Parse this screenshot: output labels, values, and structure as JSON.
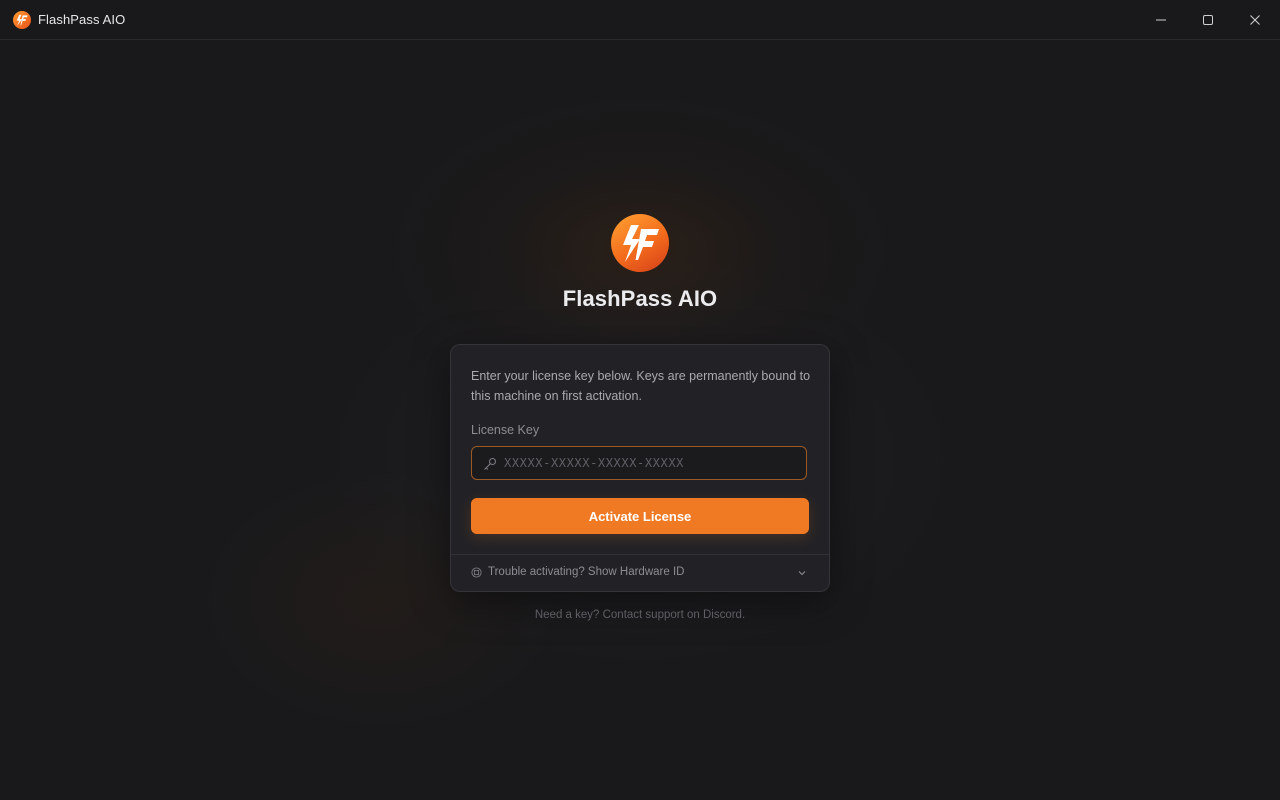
{
  "window": {
    "title": "FlashPass AIO",
    "controls": {
      "minimize": "minimize-icon",
      "maximize": "maximize-icon",
      "close": "close-icon"
    }
  },
  "brand": {
    "name": "FlashPass AIO",
    "logo_icon": "flash-logo-icon",
    "accent_color": "#f07a24"
  },
  "card": {
    "description": "Enter your license key below. Keys are permanently bound to this machine on first activation.",
    "license_label": "License Key",
    "license_input": {
      "placeholder": "XXXXX-XXXXX-XXXXX-XXXXX",
      "value": "",
      "icon": "key-icon"
    },
    "activate_label": "Activate License",
    "trouble": {
      "label": "Trouble activating? Show Hardware ID",
      "icon": "chip-icon",
      "expand_icon": "chevron-down-icon"
    }
  },
  "footer": {
    "note": "Need a key? Contact support on Discord."
  }
}
